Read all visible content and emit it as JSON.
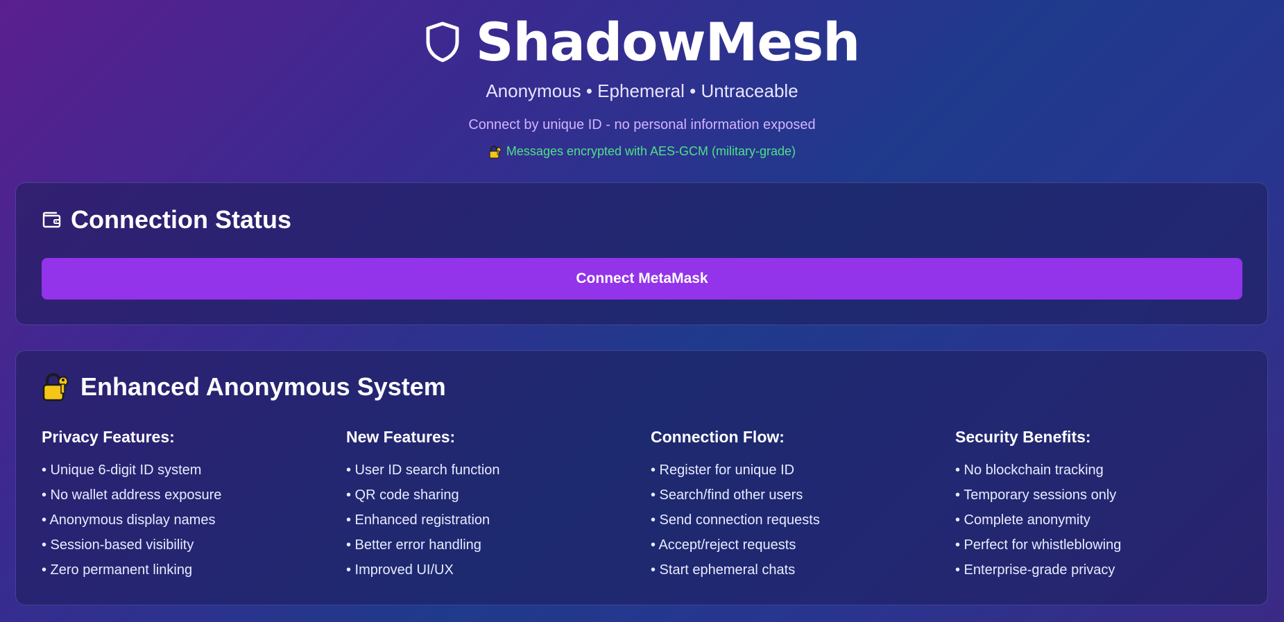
{
  "header": {
    "title": "ShadowMesh",
    "tagline": "Anonymous • Ephemeral • Untraceable",
    "subtitle": "Connect by unique ID - no personal information exposed",
    "encryption_note": "Messages encrypted with AES-GCM (military-grade)"
  },
  "status_card": {
    "title": "Connection Status",
    "connect_button": "Connect MetaMask"
  },
  "anon_card": {
    "title": "Enhanced Anonymous System",
    "columns": [
      {
        "heading": "Privacy Features:",
        "items": [
          "• Unique 6-digit ID system",
          "• No wallet address exposure",
          "• Anonymous display names",
          "• Session-based visibility",
          "• Zero permanent linking"
        ]
      },
      {
        "heading": "New Features:",
        "items": [
          "• User ID search function",
          "• QR code sharing",
          "• Enhanced registration",
          "• Better error handling",
          "• Improved UI/UX"
        ]
      },
      {
        "heading": "Connection Flow:",
        "items": [
          "• Register for unique ID",
          "• Search/find other users",
          "• Send connection requests",
          "• Accept/reject requests",
          "• Start ephemeral chats"
        ]
      },
      {
        "heading": "Security Benefits:",
        "items": [
          "• No blockchain tracking",
          "• Temporary sessions only",
          "• Complete anonymity",
          "• Perfect for whistleblowing",
          "• Enterprise-grade privacy"
        ]
      }
    ]
  },
  "colors": {
    "accent_button": "#9333ea",
    "encryption_green": "#4ee08a",
    "subtitle_purple": "#d4b4ff"
  },
  "icons": {
    "title": "shield-icon",
    "encryption": "lock-key-icon",
    "status": "wallet-icon",
    "anon": "lock-key-icon"
  }
}
